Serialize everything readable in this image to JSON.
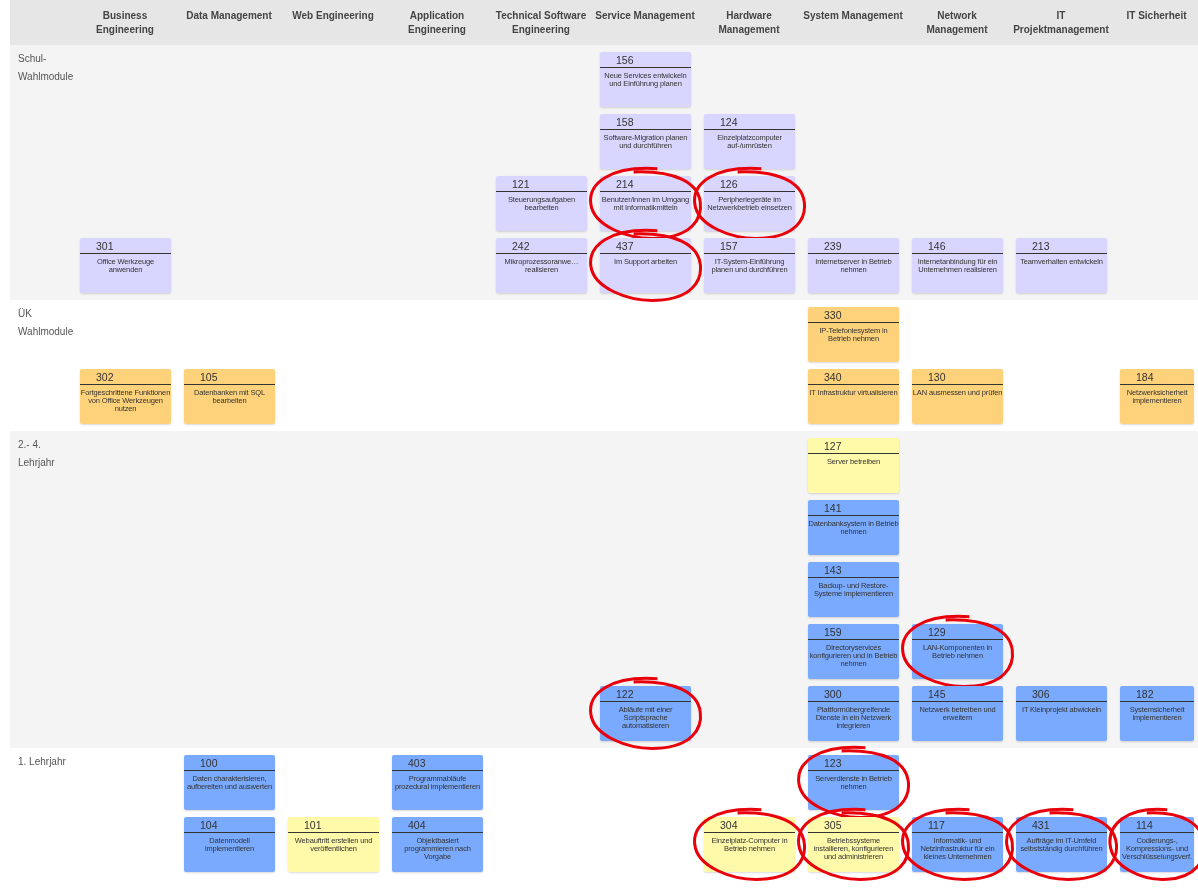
{
  "columns": [
    "Business Engineering",
    "Data Management",
    "Web Engineering",
    "Application Engineering",
    "Technical Software Engineering",
    "Service Management",
    "Hardware Management",
    "System Management",
    "Network Management",
    "IT Projektmanagement",
    "IT Sicherheit"
  ],
  "sections": [
    {
      "label": "Schul-\nWahlmodule",
      "rows": [
        [
          null,
          null,
          null,
          null,
          null,
          {
            "number": "156",
            "title": "Neue Services entwickeln und Einführung planen",
            "color": "#d8d6fe",
            "circled": false
          },
          null,
          null,
          null,
          null,
          null
        ],
        [
          null,
          null,
          null,
          null,
          null,
          {
            "number": "158",
            "title": "Software-Migration planen und durchführen",
            "color": "#d8d6fe",
            "circled": false
          },
          {
            "number": "124",
            "title": "Einzelplatzcomputer auf-/umrüsten",
            "color": "#d8d6fe",
            "circled": false
          },
          null,
          null,
          null,
          null
        ],
        [
          null,
          null,
          null,
          null,
          {
            "number": "121",
            "title": "Steuerungsaufgaben bearbeiten",
            "color": "#d8d6fe",
            "circled": false
          },
          {
            "number": "214",
            "title": "Benutzer/innen im Umgang mit Informatikmitteln",
            "color": "#d8d6fe",
            "circled": true
          },
          {
            "number": "126",
            "title": "Peripheriegeräte im Netzwerkbetrieb einsetzen",
            "color": "#d8d6fe",
            "circled": true
          },
          null,
          null,
          null,
          null
        ],
        [
          {
            "number": "301",
            "title": "Office Werkzeuge anwenden",
            "color": "#d8d6fe",
            "circled": false
          },
          null,
          null,
          null,
          {
            "number": "242",
            "title": "Mikroprozessoranwe… realisieren",
            "color": "#d8d6fe",
            "circled": false
          },
          {
            "number": "437",
            "title": "Im Support arbeiten",
            "color": "#d8d6fe",
            "circled": true
          },
          {
            "number": "157",
            "title": "IT-System-Einführung planen und durchführen",
            "color": "#d8d6fe",
            "circled": false
          },
          {
            "number": "239",
            "title": "Internetserver in Betrieb nehmen",
            "color": "#d8d6fe",
            "circled": false
          },
          {
            "number": "146",
            "title": "Internetanbindung für ein Unternehmen realisieren",
            "color": "#d8d6fe",
            "circled": false
          },
          {
            "number": "213",
            "title": "Teamverhalten entwickeln",
            "color": "#d8d6fe",
            "circled": false
          },
          null
        ]
      ]
    },
    {
      "label": "ÜK\nWahlmodule",
      "rows": [
        [
          null,
          null,
          null,
          null,
          null,
          null,
          null,
          {
            "number": "330",
            "title": "IP-Telefoniesystem in Betrieb nehmen",
            "color": "#fed27a",
            "circled": false
          },
          null,
          null,
          null
        ],
        [
          {
            "number": "302",
            "title": "Fortgeschrittene Funktionen von Office Werkzeugen nutzen",
            "color": "#fed27a",
            "circled": false
          },
          {
            "number": "105",
            "title": "Datenbanken mit SQL bearbeiten",
            "color": "#fed27a",
            "circled": false
          },
          null,
          null,
          null,
          null,
          null,
          {
            "number": "340",
            "title": "IT Infrastruktur virtualisieren",
            "color": "#fed27a",
            "circled": false
          },
          {
            "number": "130",
            "title": "LAN ausmessen und prüfen",
            "color": "#fed27a",
            "circled": false
          },
          null,
          {
            "number": "184",
            "title": "Netzwerksicherheit implementieren",
            "color": "#fed27a",
            "circled": false
          }
        ]
      ]
    },
    {
      "label": "2.- 4.\nLehrjahr",
      "rows": [
        [
          null,
          null,
          null,
          null,
          null,
          null,
          null,
          {
            "number": "127",
            "title": "Server betreiben",
            "color": "#fffaa9",
            "circled": false
          },
          null,
          null,
          null
        ],
        [
          null,
          null,
          null,
          null,
          null,
          null,
          null,
          {
            "number": "141",
            "title": "Datenbanksystem in Betrieb nehmen",
            "color": "#7aaafe",
            "circled": false
          },
          null,
          null,
          null
        ],
        [
          null,
          null,
          null,
          null,
          null,
          null,
          null,
          {
            "number": "143",
            "title": "Backup- und Restore-Systeme implementieren",
            "color": "#7aaafe",
            "circled": false
          },
          null,
          null,
          null
        ],
        [
          null,
          null,
          null,
          null,
          null,
          null,
          null,
          {
            "number": "159",
            "title": "Directoryservices konfigurieren und in Betrieb nehmen",
            "color": "#7aaafe",
            "circled": false
          },
          {
            "number": "129",
            "title": "LAN-Komponenten in Betrieb nehmen",
            "color": "#7aaafe",
            "circled": true
          },
          null,
          null
        ],
        [
          null,
          null,
          null,
          null,
          null,
          {
            "number": "122",
            "title": "Abläufe mit einer Scriptsprache automatisieren",
            "color": "#7aaafe",
            "circled": true
          },
          null,
          {
            "number": "300",
            "title": "Plattformübergreifende Dienste in ein Netzwerk integrieren",
            "color": "#7aaafe",
            "circled": false
          },
          {
            "number": "145",
            "title": "Netzwerk betreiben und erweitern",
            "color": "#7aaafe",
            "circled": false
          },
          {
            "number": "306",
            "title": "IT Kleinprojekt abwickeln",
            "color": "#7aaafe",
            "circled": false
          },
          {
            "number": "182",
            "title": "Systemsicherheit implementieren",
            "color": "#7aaafe",
            "circled": false
          }
        ]
      ]
    },
    {
      "label": "1. Lehrjahr",
      "rows": [
        [
          null,
          {
            "number": "100",
            "title": "Daten charakterisieren, aufbereiten und auswerten",
            "color": "#7aaafe",
            "circled": false
          },
          null,
          {
            "number": "403",
            "title": "Programmabläufe prozedural implementieren",
            "color": "#7aaafe",
            "circled": false
          },
          null,
          null,
          null,
          {
            "number": "123",
            "title": "Serverdienste in Betrieb nehmen",
            "color": "#7aaafe",
            "circled": true
          },
          null,
          null,
          null
        ],
        [
          null,
          {
            "number": "104",
            "title": "Datenmodell implementieren",
            "color": "#7aaafe",
            "circled": false
          },
          {
            "number": "101",
            "title": "Webauftritt erstellen und veröffentlichen",
            "color": "#fffaa9",
            "circled": false
          },
          {
            "number": "404",
            "title": "Objektbasiert programmieren nach Vorgabe",
            "color": "#7aaafe",
            "circled": false
          },
          null,
          null,
          {
            "number": "304",
            "title": "Einzelplatz-Computer in Betrieb nehmen",
            "color": "#fffaa9",
            "circled": true
          },
          {
            "number": "305",
            "title": "Betriebssysteme installieren, konfigurieren und administrieren",
            "color": "#fffaa9",
            "circled": true
          },
          {
            "number": "117",
            "title": "Informatik- und Netzinfrastruktur für ein kleines Unternehmen",
            "color": "#7aaafe",
            "circled": true
          },
          {
            "number": "431",
            "title": "Aufträge im IT-Umfeld selbstständig durchführen",
            "color": "#7aaafe",
            "circled": true
          },
          {
            "number": "114",
            "title": "Codierungs-, Kompressions- und Verschlüsselungsverf.",
            "color": "#7aaafe",
            "circled": true
          }
        ]
      ]
    }
  ]
}
